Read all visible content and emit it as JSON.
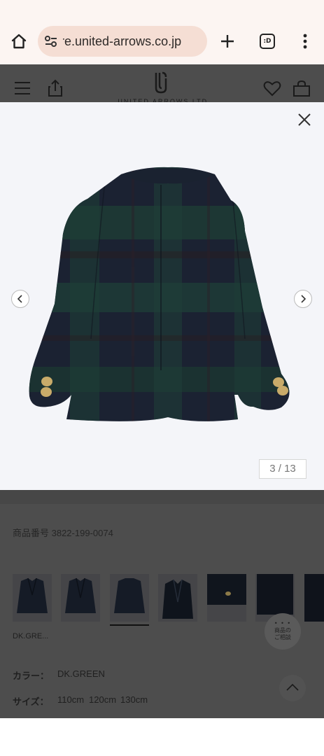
{
  "browser": {
    "url": "store.united-arrows.co.jp",
    "tab_badge": ":D",
    "icons": [
      "home-icon",
      "site-settings-icon",
      "plus-icon",
      "tabs-icon",
      "more-vert-icon"
    ]
  },
  "site_header": {
    "brand_text": "UNITED ARROWS LTD.",
    "icons": [
      "menu-icon",
      "share-icon",
      "logo-icon",
      "favorite-heart-icon",
      "shopping-bag-icon"
    ]
  },
  "viewer": {
    "counter": "3 / 13",
    "icons": [
      "close-icon",
      "chevron-left-icon",
      "chevron-right-icon"
    ]
  },
  "product": {
    "product_number": "商品番号 3822-199-0074",
    "thumbnails": [
      {
        "label": "thumbnail-1",
        "selected": false
      },
      {
        "label": "thumbnail-2",
        "selected": false
      },
      {
        "label": "thumbnail-3",
        "selected": true
      },
      {
        "label": "thumbnail-4",
        "selected": false
      },
      {
        "label": "thumbnail-5",
        "selected": false
      },
      {
        "label": "thumbnail-6",
        "selected": false
      },
      {
        "label": "thumbnail-7",
        "selected": false
      }
    ],
    "thumbnail_caption": "DK.GRE...",
    "consult_dots": "• • •",
    "consult_line1": "商品の",
    "consult_line2": "ご相談",
    "color_label": "カラー：",
    "color_value": "DK.GREEN",
    "size_label": "サイズ：",
    "sizes": [
      "110cm",
      "120cm",
      "130cm"
    ]
  },
  "colors": {
    "browser_bg": "#fcf5f2",
    "url_pill": "#f5ded4",
    "overlay": "#4d4d4d",
    "jacket_navy": "#1c2434",
    "jacket_green": "#1e3f37",
    "button_gold": "#c9ab6a"
  }
}
